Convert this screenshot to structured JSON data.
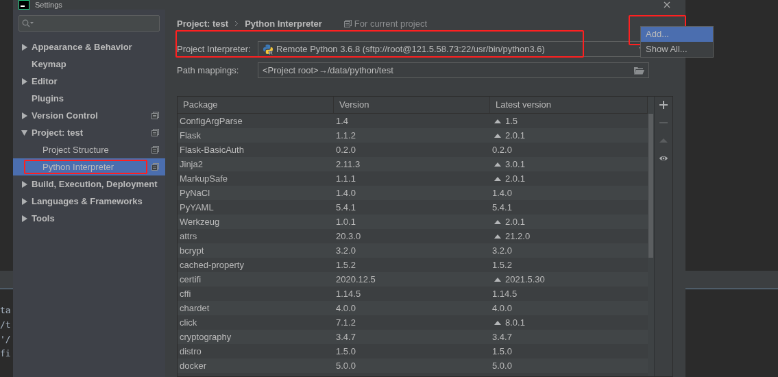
{
  "window": {
    "title": "Settings"
  },
  "background_terminal": {
    "lines": [
      "ta",
      "/t",
      "'/",
      "fi"
    ]
  },
  "sidebar": {
    "items": [
      {
        "label": "Appearance & Behavior",
        "kind": "group",
        "expanded": false,
        "selected": false,
        "project_scoped": false,
        "marked": false
      },
      {
        "label": "Keymap",
        "kind": "leaf",
        "selected": false,
        "project_scoped": false,
        "marked": false
      },
      {
        "label": "Editor",
        "kind": "group",
        "expanded": false,
        "selected": false,
        "project_scoped": false,
        "marked": false
      },
      {
        "label": "Plugins",
        "kind": "leaf",
        "selected": false,
        "project_scoped": false,
        "marked": false
      },
      {
        "label": "Version Control",
        "kind": "group",
        "expanded": false,
        "selected": false,
        "project_scoped": true,
        "marked": false
      },
      {
        "label": "Project: test",
        "kind": "group",
        "expanded": true,
        "selected": false,
        "project_scoped": true,
        "marked": false,
        "children": [
          {
            "label": "Project Structure",
            "kind": "leaf",
            "selected": false,
            "project_scoped": true,
            "marked": false
          },
          {
            "label": "Python Interpreter",
            "kind": "leaf",
            "selected": true,
            "project_scoped": true,
            "marked": true
          }
        ]
      },
      {
        "label": "Build, Execution, Deployment",
        "kind": "group",
        "expanded": false,
        "selected": false,
        "project_scoped": false,
        "marked": false
      },
      {
        "label": "Languages & Frameworks",
        "kind": "group",
        "expanded": false,
        "selected": false,
        "project_scoped": false,
        "marked": false
      },
      {
        "label": "Tools",
        "kind": "group",
        "expanded": false,
        "selected": false,
        "project_scoped": false,
        "marked": false
      }
    ]
  },
  "breadcrumb": {
    "items": [
      "Project: test",
      "Python Interpreter"
    ],
    "scope": "For current project"
  },
  "interpreter": {
    "label": "Project Interpreter:",
    "value": "Remote Python 3.6.8 (sftp://root@121.5.58.73:22/usr/bin/python3.6)",
    "marked": true
  },
  "path_mappings": {
    "label": "Path mappings:",
    "value": "<Project root>→/data/python/test"
  },
  "gear_menu": {
    "items": [
      {
        "label": "Add...",
        "selected": true,
        "marked": true
      },
      {
        "label": "Show All...",
        "selected": false,
        "marked": false
      }
    ]
  },
  "table": {
    "columns": [
      "Package",
      "Version",
      "Latest version"
    ],
    "rows": [
      {
        "package": "ConfigArgParse",
        "version": "1.4",
        "latest": "1.5",
        "upgrade": true
      },
      {
        "package": "Flask",
        "version": "1.1.2",
        "latest": "2.0.1",
        "upgrade": true
      },
      {
        "package": "Flask-BasicAuth",
        "version": "0.2.0",
        "latest": "0.2.0",
        "upgrade": false
      },
      {
        "package": "Jinja2",
        "version": "2.11.3",
        "latest": "3.0.1",
        "upgrade": true
      },
      {
        "package": "MarkupSafe",
        "version": "1.1.1",
        "latest": "2.0.1",
        "upgrade": true
      },
      {
        "package": "PyNaCl",
        "version": "1.4.0",
        "latest": "1.4.0",
        "upgrade": false
      },
      {
        "package": "PyYAML",
        "version": "5.4.1",
        "latest": "5.4.1",
        "upgrade": false
      },
      {
        "package": "Werkzeug",
        "version": "1.0.1",
        "latest": "2.0.1",
        "upgrade": true
      },
      {
        "package": "attrs",
        "version": "20.3.0",
        "latest": "21.2.0",
        "upgrade": true
      },
      {
        "package": "bcrypt",
        "version": "3.2.0",
        "latest": "3.2.0",
        "upgrade": false
      },
      {
        "package": "cached-property",
        "version": "1.5.2",
        "latest": "1.5.2",
        "upgrade": false
      },
      {
        "package": "certifi",
        "version": "2020.12.5",
        "latest": "2021.5.30",
        "upgrade": true
      },
      {
        "package": "cffi",
        "version": "1.14.5",
        "latest": "1.14.5",
        "upgrade": false
      },
      {
        "package": "chardet",
        "version": "4.0.0",
        "latest": "4.0.0",
        "upgrade": false
      },
      {
        "package": "click",
        "version": "7.1.2",
        "latest": "8.0.1",
        "upgrade": true
      },
      {
        "package": "cryptography",
        "version": "3.4.7",
        "latest": "3.4.7",
        "upgrade": false
      },
      {
        "package": "distro",
        "version": "1.5.0",
        "latest": "1.5.0",
        "upgrade": false
      },
      {
        "package": "docker",
        "version": "5.0.0",
        "latest": "5.0.0",
        "upgrade": false
      }
    ]
  },
  "table_tools": [
    {
      "kind": "add",
      "disabled": false
    },
    {
      "kind": "remove",
      "disabled": true
    },
    {
      "kind": "upgrade",
      "disabled": true
    },
    {
      "kind": "show",
      "disabled": false
    }
  ]
}
